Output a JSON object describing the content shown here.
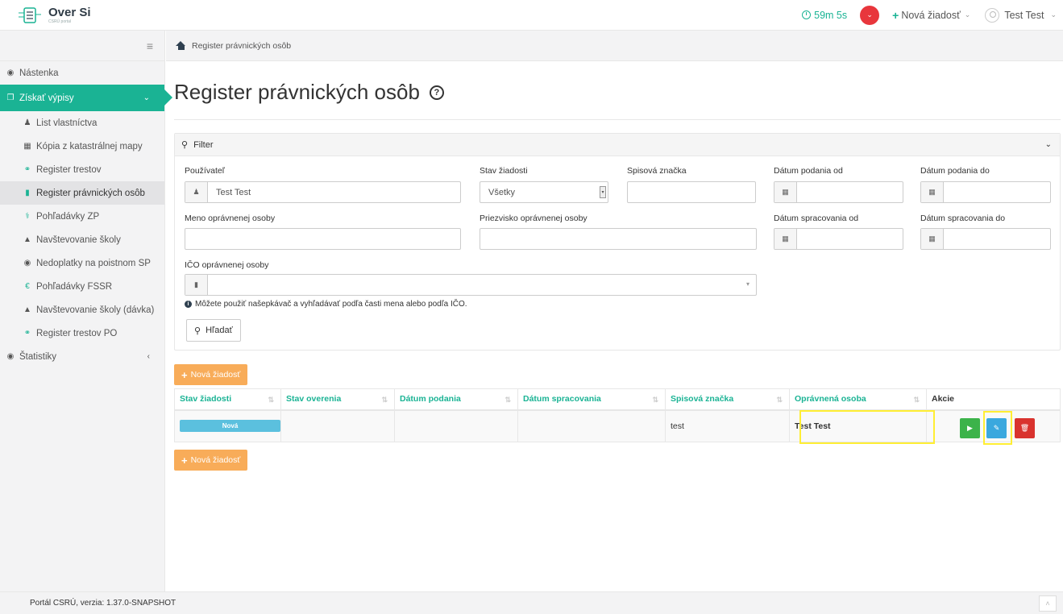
{
  "app": {
    "title": "Over Si",
    "subtitle": "CSRÚ portal"
  },
  "topbar": {
    "timer": "59m 5s",
    "new_request_label": "Nová žiadosť",
    "user_name": "Test Test"
  },
  "sidebar": {
    "items": [
      {
        "label": "Nástenka",
        "icon": "dashboard-icon"
      },
      {
        "label": "Získať výpisy",
        "icon": "documents-icon"
      },
      {
        "label": "List vlastníctva",
        "icon": "users-icon"
      },
      {
        "label": "Kópia z katastrálnej mapy",
        "icon": "map-icon"
      },
      {
        "label": "Register trestov",
        "icon": "link-icon"
      },
      {
        "label": "Register právnických osôb",
        "icon": "building-icon"
      },
      {
        "label": "Pohľadávky ZP",
        "icon": "health-icon"
      },
      {
        "label": "Navštevovanie školy",
        "icon": "graduation-cap-icon"
      },
      {
        "label": "Nedoplatky na poistnom SP",
        "icon": "globe-icon"
      },
      {
        "label": "Pohľadávky FSSR",
        "icon": "euro-icon"
      },
      {
        "label": "Navštevovanie školy (dávka)",
        "icon": "graduation-cap-icon"
      },
      {
        "label": "Register trestov PO",
        "icon": "link-icon"
      },
      {
        "label": "Štatistiky",
        "icon": "dashboard-icon"
      }
    ]
  },
  "breadcrumb": {
    "current": "Register právnických osôb"
  },
  "page": {
    "title": "Register právnických osôb",
    "help_icon": "?"
  },
  "filter": {
    "header": "Filter",
    "user_label": "Používateľ",
    "user_value": "Test Test",
    "status_label": "Stav žiadosti",
    "status_value": "Všetky",
    "file_no_label": "Spisová značka",
    "file_no_value": "",
    "date_from_label": "Dátum podania od",
    "date_to_label": "Dátum podania do",
    "name_label": "Meno oprávnenej osoby",
    "surname_label": "Priezvisko oprávnenej osoby",
    "proc_from_label": "Dátum spracovania od",
    "proc_to_label": "Dátum spracovania do",
    "ico_label": "IČO oprávnenej osoby",
    "info_text": "Môžete použiť našepkávač a vyhľadávať podľa časti mena alebo podľa IČO.",
    "search_button": "Hľadať"
  },
  "actions": {
    "new_request_button": "Nová žiadosť"
  },
  "table": {
    "columns": [
      "Stav žiadosti",
      "Stav overenia",
      "Dátum podania",
      "Dátum spracovania",
      "Spisová značka",
      "Oprávnená osoba",
      "Akcie"
    ],
    "rows": [
      {
        "status": "Nová",
        "verification": "",
        "submitted": "",
        "processed": "",
        "file_no": "test",
        "person": "Test Test"
      }
    ]
  },
  "footer": {
    "version": "Portál CSRÚ, verzia: 1.37.0-SNAPSHOT"
  },
  "colors": {
    "accent": "#1ab394",
    "orange": "#f8ac59",
    "info": "#5bc0de",
    "danger": "#ed5565",
    "highlight": "#ffee33"
  }
}
